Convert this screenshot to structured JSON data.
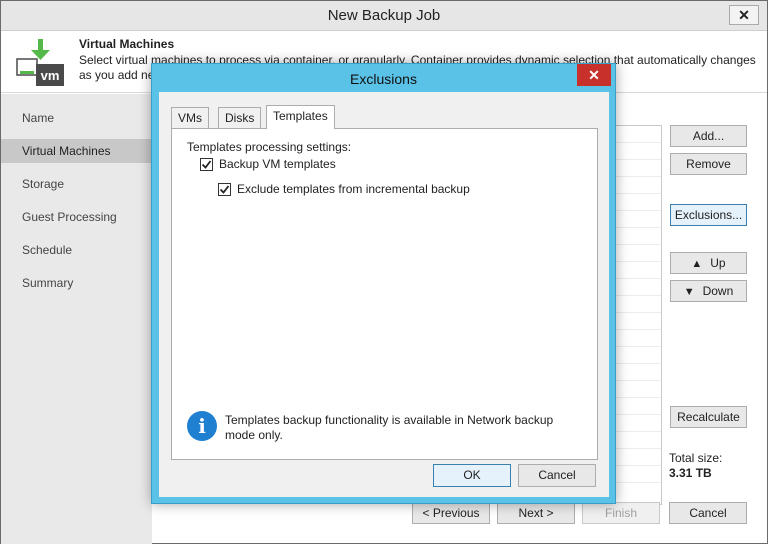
{
  "window": {
    "title": "New Backup Job",
    "close_glyph": "✕"
  },
  "header": {
    "title": "Virtual Machines",
    "description": "Select virtual machines to process via container, or granularly. Container provides dynamic selection that automatically changes as you add new"
  },
  "sidebar": {
    "items": [
      {
        "label": "Name"
      },
      {
        "label": "Virtual Machines"
      },
      {
        "label": "Storage"
      },
      {
        "label": "Guest Processing"
      },
      {
        "label": "Schedule"
      },
      {
        "label": "Summary"
      }
    ]
  },
  "right_buttons": {
    "add": "Add...",
    "remove": "Remove",
    "exclusions": "Exclusions...",
    "up": "Up",
    "down": "Down",
    "recalculate": "Recalculate"
  },
  "total": {
    "label": "Total size:",
    "value": "3.31 TB"
  },
  "footer": {
    "previous": "< Previous",
    "next": "Next >",
    "finish": "Finish",
    "cancel": "Cancel"
  },
  "dialog": {
    "title": "Exclusions",
    "close_glyph": "✕",
    "tabs": [
      {
        "label": "VMs"
      },
      {
        "label": "Disks"
      },
      {
        "label": "Templates"
      }
    ],
    "active_tab": "Templates",
    "settings_label": "Templates processing settings:",
    "backup_templates": {
      "label": "Backup VM templates",
      "checked": true
    },
    "exclude_incremental": {
      "label": "Exclude templates from incremental backup",
      "checked": true
    },
    "info_glyph": "i",
    "info_text": "Templates backup functionality is available in Network backup mode only.",
    "ok": "OK",
    "cancel": "Cancel"
  },
  "colors": {
    "dialog_frame": "#5bc2e7",
    "close_button": "#c7302b",
    "info_icon": "#1f7fd0",
    "sidebar_active": "#c8c8c8",
    "brand_green": "#54b948"
  },
  "icons": {
    "header": "vm-download-icon",
    "up": "arrow-up-icon",
    "down": "arrow-down-icon",
    "info": "info-icon"
  }
}
